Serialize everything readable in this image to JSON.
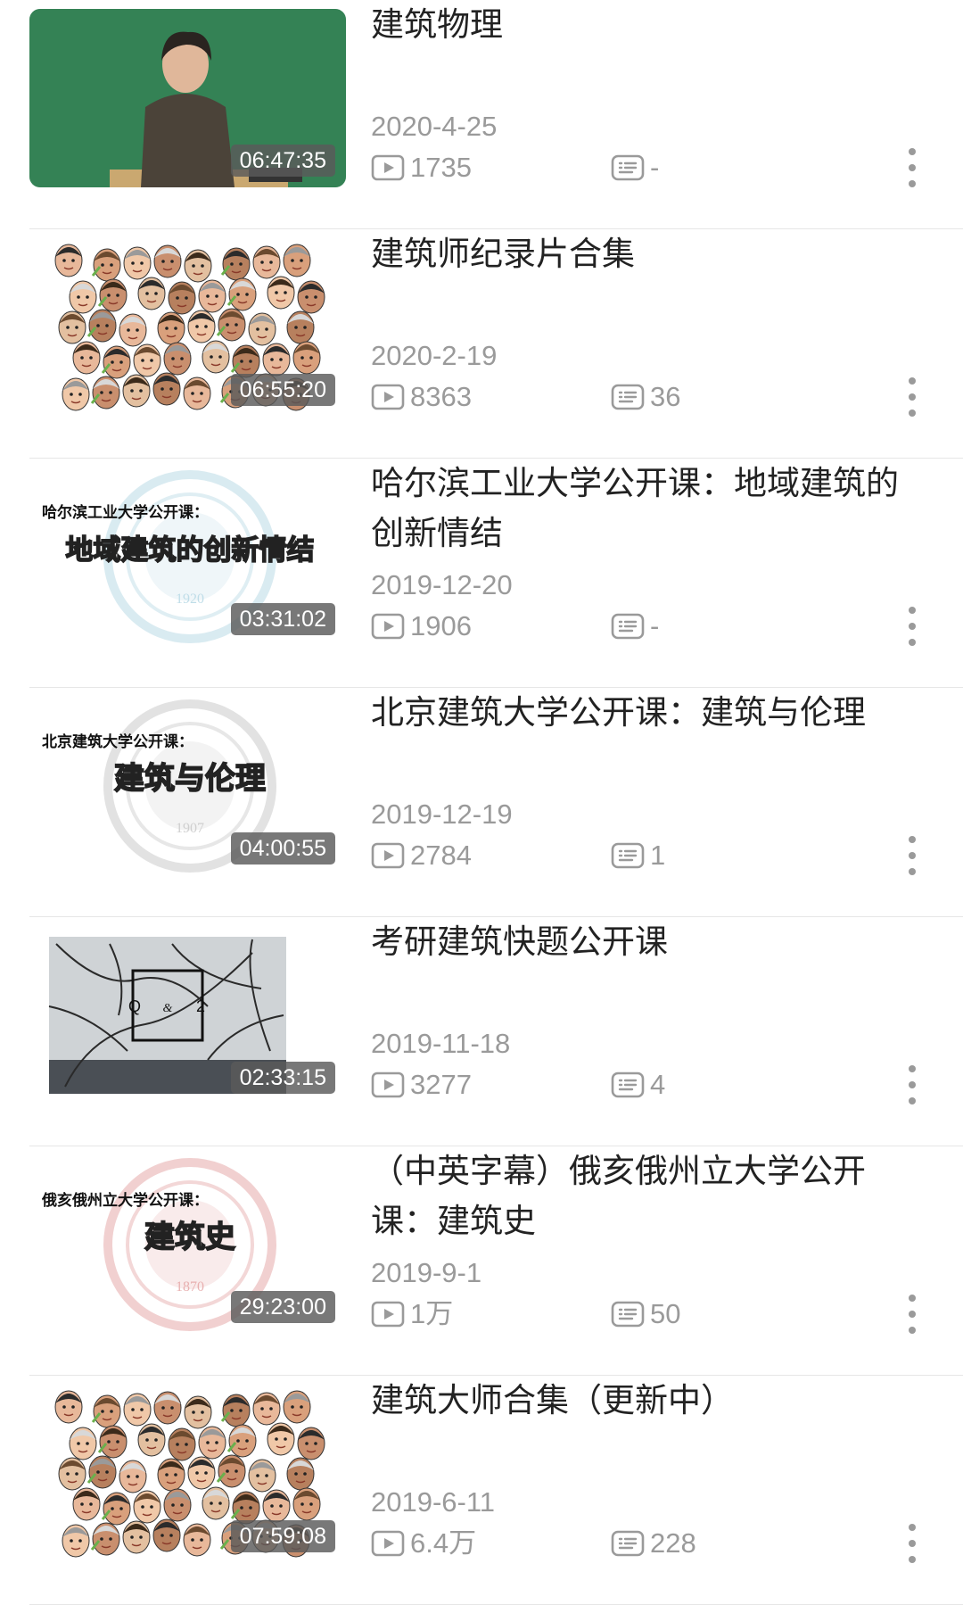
{
  "colors": {
    "meta": "#9a9a9a",
    "title": "#222222",
    "divider": "#e6e6e6"
  },
  "videos": [
    {
      "title": "建筑物理",
      "duration": "06:47:35",
      "date": "2020-4-25",
      "plays": "1735",
      "danmaku": "-",
      "thumb": "lecture"
    },
    {
      "title": "建筑师纪录片合集",
      "duration": "06:55:20",
      "date": "2020-2-19",
      "plays": "8363",
      "danmaku": "36",
      "thumb": "faces"
    },
    {
      "title": "哈尔滨工业大学公开课：地域建筑的创新情结",
      "duration": "03:31:02",
      "date": "2019-12-20",
      "plays": "1906",
      "danmaku": "-",
      "thumb": "seal",
      "cover_small": "哈尔滨工业大学公开课：",
      "cover_big": "地域建筑的创新情结",
      "cover_year": "1920"
    },
    {
      "title": "北京建筑大学公开课：建筑与伦理",
      "duration": "04:00:55",
      "date": "2019-12-19",
      "plays": "2784",
      "danmaku": "1",
      "thumb": "seal",
      "cover_small": "北京建筑大学公开课：",
      "cover_big": "建筑与伦理",
      "cover_year": "1907"
    },
    {
      "title": "考研建筑快题公开课",
      "duration": "02:33:15",
      "date": "2019-11-18",
      "plays": "3277",
      "danmaku": "4",
      "thumb": "branches",
      "cover_q": "Q",
      "cover_amp": "&",
      "cover_a": "2"
    },
    {
      "title": "（中英字幕）俄亥俄州立大学公开课：建筑史",
      "duration": "29:23:00",
      "date": "2019-9-1",
      "plays": "1万",
      "danmaku": "50",
      "thumb": "seal",
      "cover_small": "俄亥俄州立大学公开课：",
      "cover_big": "建筑史",
      "cover_year": "1870"
    },
    {
      "title": "建筑大师合集（更新中）",
      "duration": "07:59:08",
      "date": "2019-6-11",
      "plays": "6.4万",
      "danmaku": "228",
      "thumb": "faces"
    }
  ]
}
